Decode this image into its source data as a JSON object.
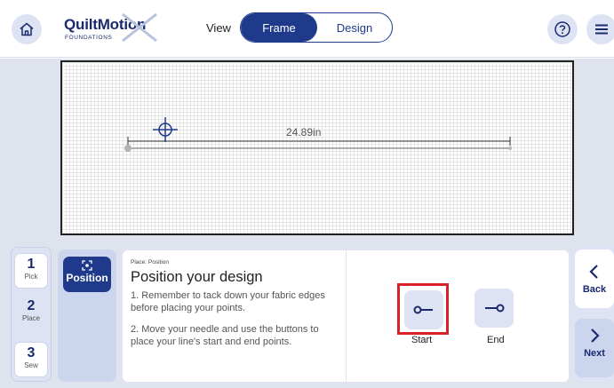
{
  "header": {
    "logo_main": "QuiltMotion",
    "logo_sub": "FOUNDATIONS",
    "view_label": "View",
    "tabs": [
      {
        "label": "Frame",
        "active": true
      },
      {
        "label": "Design",
        "active": false
      }
    ]
  },
  "canvas": {
    "line_length": "24.89in"
  },
  "steps": [
    {
      "number": "1",
      "label": "Pick"
    },
    {
      "number": "2",
      "label": "Place"
    },
    {
      "number": "3",
      "label": "Sew"
    }
  ],
  "substep": {
    "label": "Position"
  },
  "content": {
    "breadcrumb": "Place: Position",
    "title": "Position your design",
    "instruction_1": "1. Remember to tack down your fabric edges before placing your points.",
    "instruction_2": "2. Move your needle and use the buttons to place your line's start and end points."
  },
  "actions": {
    "start_label": "Start",
    "end_label": "End"
  },
  "nav": {
    "back_label": "Back",
    "next_label": "Next"
  },
  "colors": {
    "primary": "#1f3a8a",
    "highlight": "#d6232a",
    "panel": "#dde3f3",
    "background": "#dfe3ed"
  }
}
